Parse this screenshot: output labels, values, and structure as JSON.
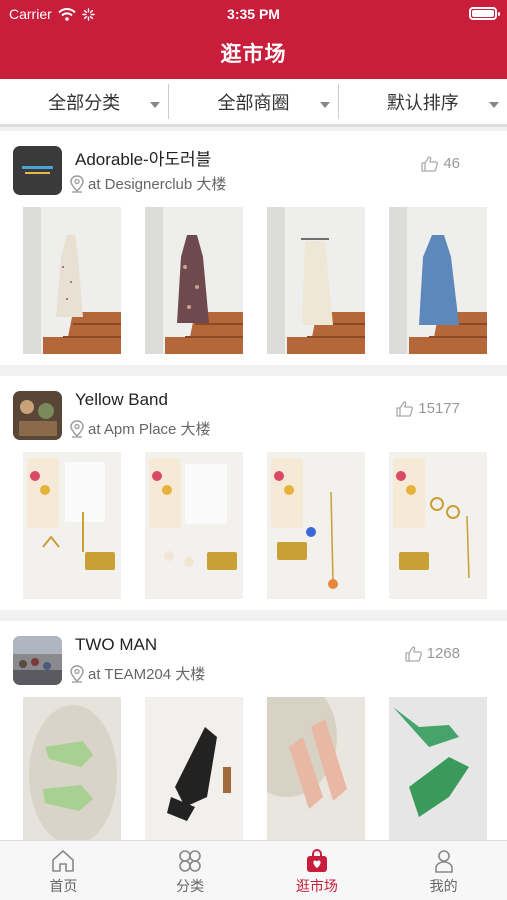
{
  "status_bar": {
    "carrier": "Carrier",
    "time": "3:35 PM"
  },
  "header": {
    "title": "逛市场"
  },
  "filters": [
    {
      "label": "全部分类"
    },
    {
      "label": "全部商圈"
    },
    {
      "label": "默认排序"
    }
  ],
  "stores": [
    {
      "name": "Adorable-아도러블",
      "location": "at Designerclub 大楼",
      "likes": "46"
    },
    {
      "name": "Yellow Band",
      "location": "at Apm Place 大楼",
      "likes": "15177"
    },
    {
      "name": "TWO MAN",
      "location": "at TEAM204 大楼",
      "likes": "1268"
    }
  ],
  "tabbar": [
    {
      "label": "首页",
      "icon": "home-icon"
    },
    {
      "label": "分类",
      "icon": "category-icon"
    },
    {
      "label": "逛市场",
      "icon": "shopping-bag-icon",
      "active": true
    },
    {
      "label": "我的",
      "icon": "profile-icon"
    }
  ],
  "colors": {
    "brand": "#c81e3c"
  }
}
